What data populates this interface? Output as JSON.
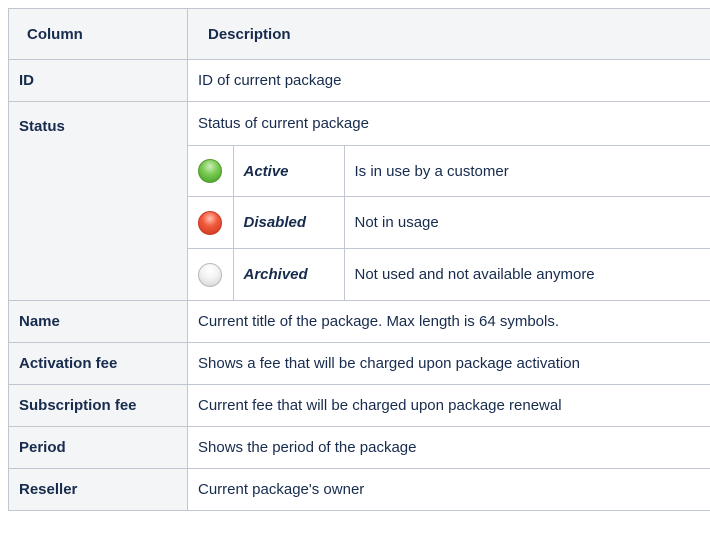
{
  "header": {
    "column": "Column",
    "description": "Description"
  },
  "rows": {
    "id": {
      "key": "ID",
      "value": "ID of current package"
    },
    "status": {
      "key": "Status",
      "value": "Status of current package",
      "states": [
        {
          "icon": "green-status-dot-icon",
          "color": "#6cbf45",
          "name": "Active",
          "description": "Is in use by a customer"
        },
        {
          "icon": "red-status-dot-icon",
          "color": "#e9472c",
          "name": "Disabled",
          "description": "Not in usage"
        },
        {
          "icon": "white-status-dot-icon",
          "color": "#e8e8e8",
          "name": "Archived",
          "description": "Not used and not available anymore"
        }
      ]
    },
    "name": {
      "key": "Name",
      "value": "Current title of the package. Max length is 64 symbols."
    },
    "activation_fee": {
      "key": "Activation fee",
      "value": "Shows a fee that will be charged upon package activation"
    },
    "subscription_fee": {
      "key": "Subscription fee",
      "value": "Current fee that will be charged upon package renewal"
    },
    "period": {
      "key": "Period",
      "value": "Shows the period of the package"
    },
    "reseller": {
      "key": "Reseller",
      "value": "Current package's owner"
    }
  }
}
